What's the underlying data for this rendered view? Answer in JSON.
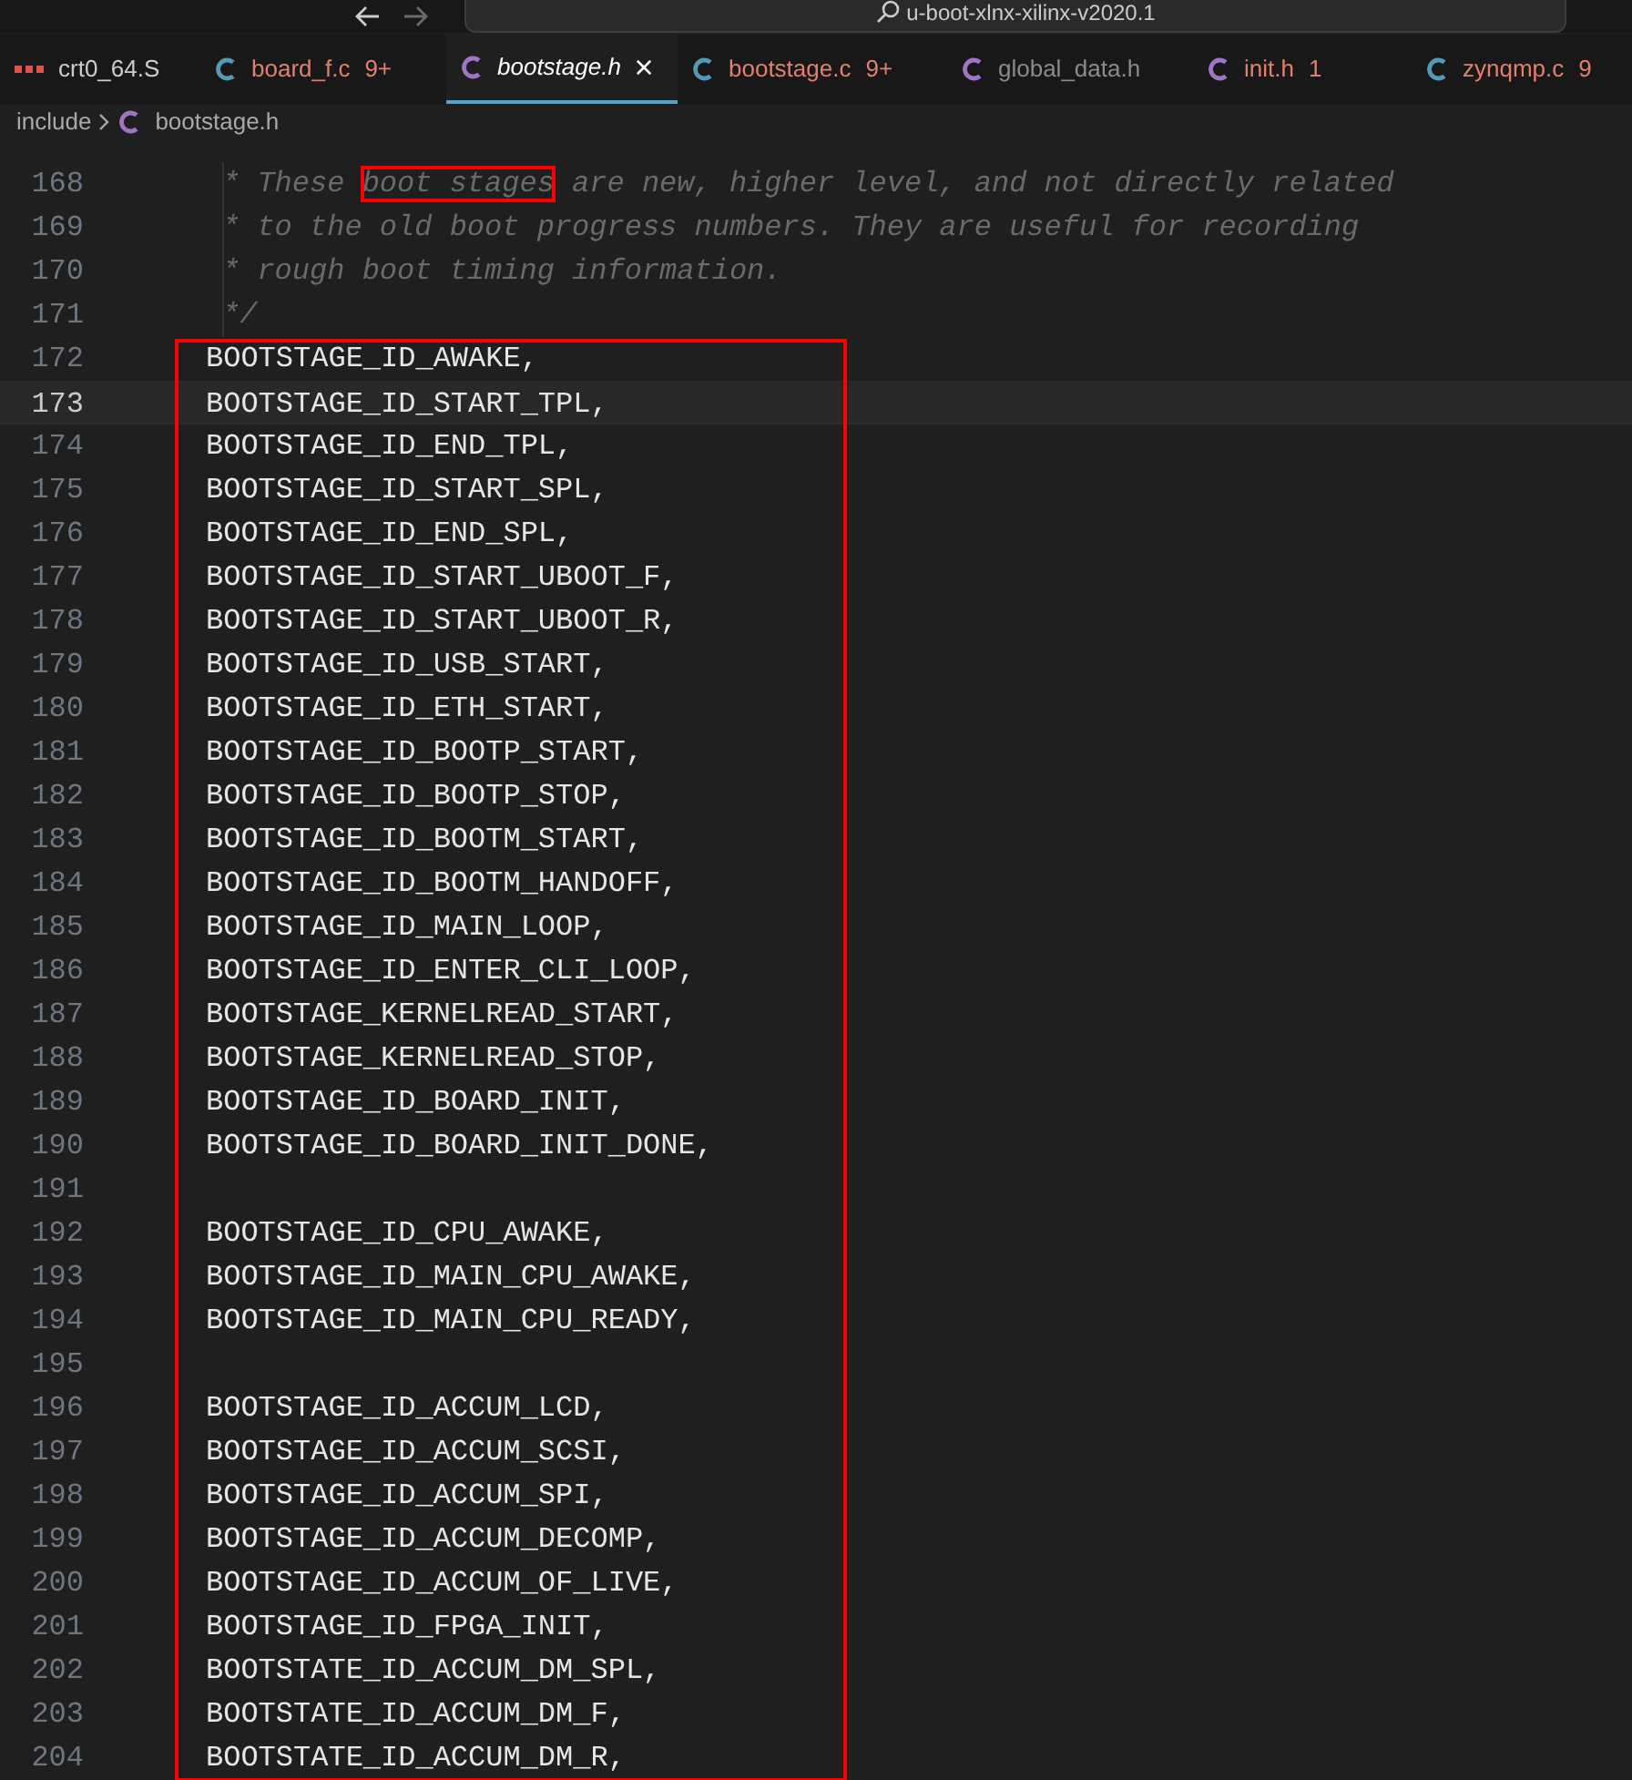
{
  "title_bar": {
    "search": "u-boot-xlnx-xilinx-v2020.1"
  },
  "tabs": [
    {
      "label": "crt0_64.S",
      "kind": "asm",
      "warning": false,
      "dimmed": false,
      "selected": false
    },
    {
      "label": "board_f.c",
      "badge": "9+",
      "kind": "c",
      "warning": true,
      "dimmed": false,
      "selected": false
    },
    {
      "label": "bootstage.h",
      "kind": "h",
      "warning": false,
      "dimmed": false,
      "selected": true
    },
    {
      "label": "bootstage.c",
      "badge": "9+",
      "kind": "c",
      "warning": true,
      "dimmed": false,
      "selected": false
    },
    {
      "label": "global_data.h",
      "kind": "h",
      "warning": false,
      "dimmed": true,
      "selected": false
    },
    {
      "label": "init.h",
      "badge": "1",
      "kind": "h",
      "warning": true,
      "dimmed": false,
      "selected": false
    },
    {
      "label": "zynqmp.c",
      "badge": "9",
      "kind": "c",
      "warning": true,
      "dimmed": false,
      "selected": false
    }
  ],
  "breadcrumb": {
    "folder": "include",
    "file": "bootstage.h"
  },
  "comment_lines": [
    {
      "number": "168",
      "before": "* These ",
      "boxed": "boot stages",
      "after": " are new, higher level, and not directly related"
    },
    {
      "number": "169",
      "before": "* to the old boot progress numbers. They are useful for recording"
    },
    {
      "number": "170",
      "before": "* rough boot timing information."
    },
    {
      "number": "171",
      "before": "*/"
    }
  ],
  "annotated_lines": [
    {
      "number": "172",
      "text": "BOOTSTAGE_ID_AWAKE,",
      "current": false
    },
    {
      "number": "173",
      "text": "BOOTSTAGE_ID_START_TPL,",
      "current": true
    },
    {
      "number": "174",
      "text": "BOOTSTAGE_ID_END_TPL,",
      "current": false
    },
    {
      "number": "175",
      "text": "BOOTSTAGE_ID_START_SPL,",
      "current": false
    },
    {
      "number": "176",
      "text": "BOOTSTAGE_ID_END_SPL,",
      "current": false
    },
    {
      "number": "177",
      "text": "BOOTSTAGE_ID_START_UBOOT_F,",
      "current": false
    },
    {
      "number": "178",
      "text": "BOOTSTAGE_ID_START_UBOOT_R,",
      "current": false
    },
    {
      "number": "179",
      "text": "BOOTSTAGE_ID_USB_START,",
      "current": false
    },
    {
      "number": "180",
      "text": "BOOTSTAGE_ID_ETH_START,",
      "current": false
    },
    {
      "number": "181",
      "text": "BOOTSTAGE_ID_BOOTP_START,",
      "current": false
    },
    {
      "number": "182",
      "text": "BOOTSTAGE_ID_BOOTP_STOP,",
      "current": false
    },
    {
      "number": "183",
      "text": "BOOTSTAGE_ID_BOOTM_START,",
      "current": false
    },
    {
      "number": "184",
      "text": "BOOTSTAGE_ID_BOOTM_HANDOFF,",
      "current": false
    },
    {
      "number": "185",
      "text": "BOOTSTAGE_ID_MAIN_LOOP,",
      "current": false
    },
    {
      "number": "186",
      "text": "BOOTSTAGE_ID_ENTER_CLI_LOOP,",
      "current": false
    },
    {
      "number": "187",
      "text": "BOOTSTAGE_KERNELREAD_START,",
      "current": false
    },
    {
      "number": "188",
      "text": "BOOTSTAGE_KERNELREAD_STOP,",
      "current": false
    },
    {
      "number": "189",
      "text": "BOOTSTAGE_ID_BOARD_INIT,",
      "current": false
    },
    {
      "number": "190",
      "text": "BOOTSTAGE_ID_BOARD_INIT_DONE,",
      "current": false
    },
    {
      "number": "191",
      "current": false
    },
    {
      "number": "192",
      "text": "BOOTSTAGE_ID_CPU_AWAKE,",
      "current": false
    },
    {
      "number": "193",
      "text": "BOOTSTAGE_ID_MAIN_CPU_AWAKE,",
      "current": false
    },
    {
      "number": "194",
      "text": "BOOTSTAGE_ID_MAIN_CPU_READY,",
      "current": false
    },
    {
      "number": "195",
      "current": false
    },
    {
      "number": "196",
      "text": "BOOTSTAGE_ID_ACCUM_LCD,",
      "current": false
    },
    {
      "number": "197",
      "text": "BOOTSTAGE_ID_ACCUM_SCSI,",
      "current": false
    },
    {
      "number": "198",
      "text": "BOOTSTAGE_ID_ACCUM_SPI,",
      "current": false
    },
    {
      "number": "199",
      "text": "BOOTSTAGE_ID_ACCUM_DECOMP,",
      "current": false
    },
    {
      "number": "200",
      "text": "BOOTSTAGE_ID_ACCUM_OF_LIVE,",
      "current": false
    },
    {
      "number": "201",
      "text": "BOOTSTAGE_ID_FPGA_INIT,",
      "current": false
    },
    {
      "number": "202",
      "text": "BOOTSTATE_ID_ACCUM_DM_SPL,",
      "current": false
    },
    {
      "number": "203",
      "text": "BOOTSTATE_ID_ACCUM_DM_F,",
      "current": false
    },
    {
      "number": "204",
      "text": "BOOTSTATE_ID_ACCUM_DM_R,",
      "current": false
    }
  ]
}
